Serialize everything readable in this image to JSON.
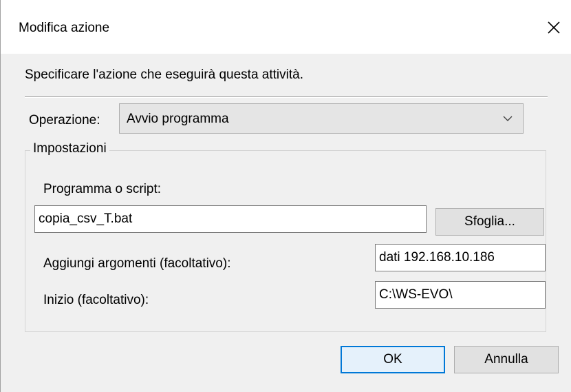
{
  "dialog": {
    "title": "Modifica azione",
    "close_icon": "close-icon",
    "instruction": "Specificare l'azione che eseguirà questa attività."
  },
  "operation": {
    "label": "Operazione:",
    "selected": "Avvio programma",
    "chevron_icon": "chevron-down-icon"
  },
  "settings": {
    "legend": "Impostazioni",
    "program_label": "Programma o script:",
    "program_value": "copia_csv_T.bat",
    "browse_label": "Sfoglia...",
    "args_label": "Aggiungi argomenti (facoltativo):",
    "args_value": "dati 192.168.10.186",
    "start_label": "Inizio (facoltativo):",
    "start_value": "C:\\WS-EVO\\"
  },
  "footer": {
    "ok_label": "OK",
    "cancel_label": "Annulla"
  },
  "colors": {
    "accent": "#0078d7",
    "dialog_bg": "#f0f0f0",
    "titlebar_bg": "#ffffff"
  }
}
